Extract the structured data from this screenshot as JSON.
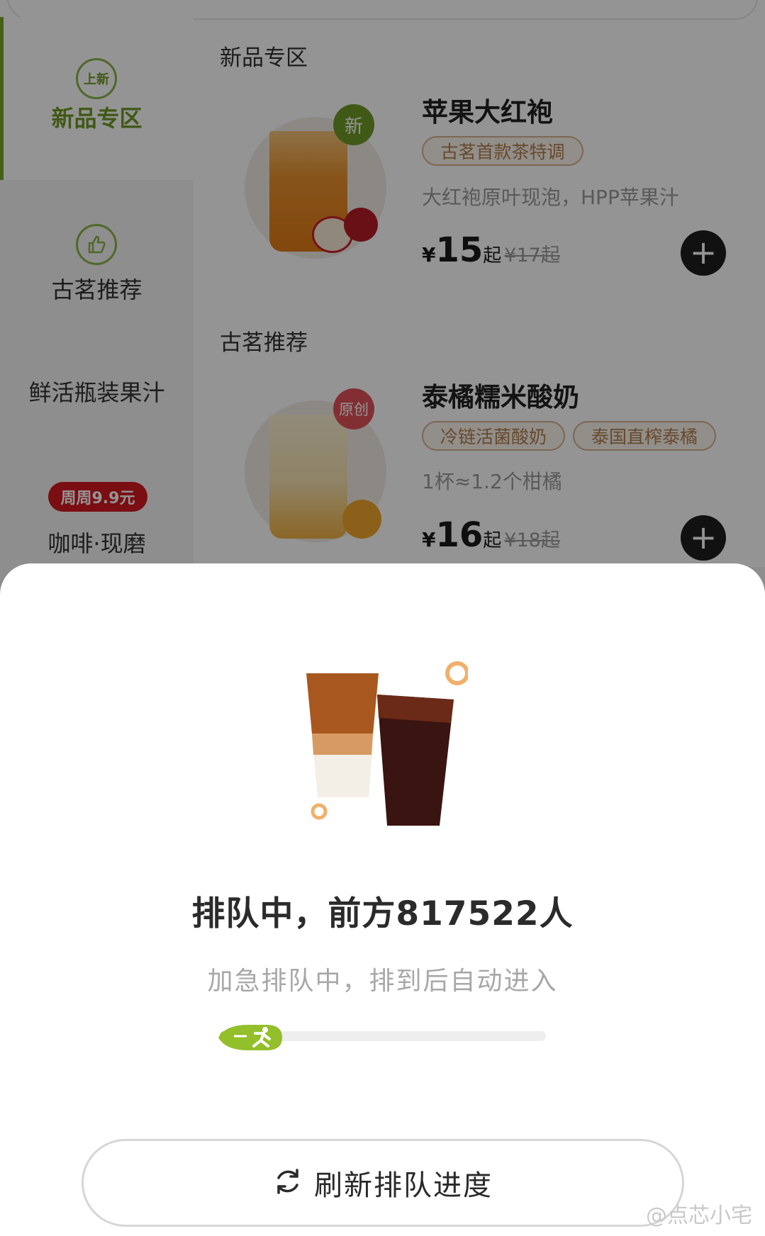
{
  "sidebar": {
    "items": [
      {
        "icon_text": "上新",
        "label": "新品专区",
        "icon": "new-badge-icon",
        "active": true
      },
      {
        "icon_text": "",
        "label": "古茗推荐",
        "icon": "thumbs-up-icon"
      },
      {
        "label": "鲜活瓶装果汁"
      },
      {
        "badge": "周周9.9元",
        "label": "咖啡·现磨"
      }
    ]
  },
  "sections": [
    {
      "title": "新品专区",
      "product": {
        "name": "苹果大红袍",
        "badge": "新",
        "tags": [
          "古茗首款茶特调"
        ],
        "description": "大红袍原叶现泡，HPP苹果汁",
        "price_symbol": "¥",
        "price": "15",
        "price_suffix": "起",
        "original_price": "¥17起"
      }
    },
    {
      "title": "古茗推荐",
      "product": {
        "name": "泰橘糯米酸奶",
        "badge": "原创",
        "tags": [
          "冷链活菌酸奶",
          "泰国直榨泰橘"
        ],
        "description": "1杯≈1.2个柑橘",
        "price_symbol": "¥",
        "price": "16",
        "price_suffix": "起",
        "original_price": "¥18起"
      }
    }
  ],
  "queue": {
    "title": "排队中，前方817522人",
    "subtitle": "加急排队中，排到后自动进入",
    "progress": 0.13,
    "refresh_label": "刷新排队进度"
  },
  "watermark": "@点芯小宅",
  "colors": {
    "accent_green": "#7aa62c",
    "progress_green": "#93bf2a",
    "tag_brown": "#b07f4f",
    "promo_red": "#d31920"
  }
}
